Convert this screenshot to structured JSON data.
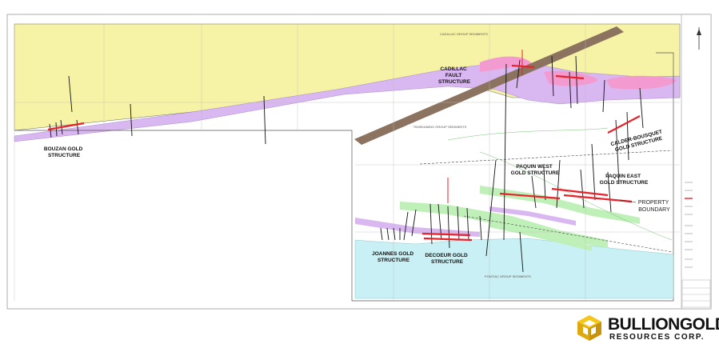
{
  "map": {
    "units": [
      "CADILLAC GROUP SEDIMENTS",
      "TIMISKAMING GROUP SEDIMENTS",
      "PONTIAC GROUP SEDIMENTS"
    ],
    "structures": {
      "cadillac_fault": [
        "CADILLAC",
        "FAULT",
        "STRUCTURE"
      ],
      "bouzan": [
        "BOUZAN GOLD",
        "STRUCTURE"
      ],
      "joannes": [
        "JOANNES GOLD",
        "STRUCTURE"
      ],
      "decoeur": [
        "DECOEUR GOLD",
        "STRUCTURE"
      ],
      "paquin_west": [
        "PAQUIN WEST",
        "GOLD STRUCTURE"
      ],
      "paquin_east": [
        "PAQUIN EAST",
        "GOLD STRUCTURE"
      ],
      "calder_bousquet": [
        "CALDER-BOUSQUET",
        "GOLD STRUCTURE"
      ]
    },
    "property_boundary": [
      "PROPERTY",
      "BOUNDARY"
    ],
    "colors": {
      "cadillac_sediments": "#f7f3a6",
      "fault_zone": "#d9b7f0",
      "pink_zone": "#f39bd0",
      "fault_line": "#8b7360",
      "pontiac_sediments": "#c9f0f4",
      "green_zone": "#bff0b8",
      "gold_structure": "#e8222a"
    }
  },
  "logo": {
    "brand": "BULLIONGOLD",
    "subtitle": "RESOURCES CORP.",
    "icon": "gold-cube-logo-icon"
  }
}
